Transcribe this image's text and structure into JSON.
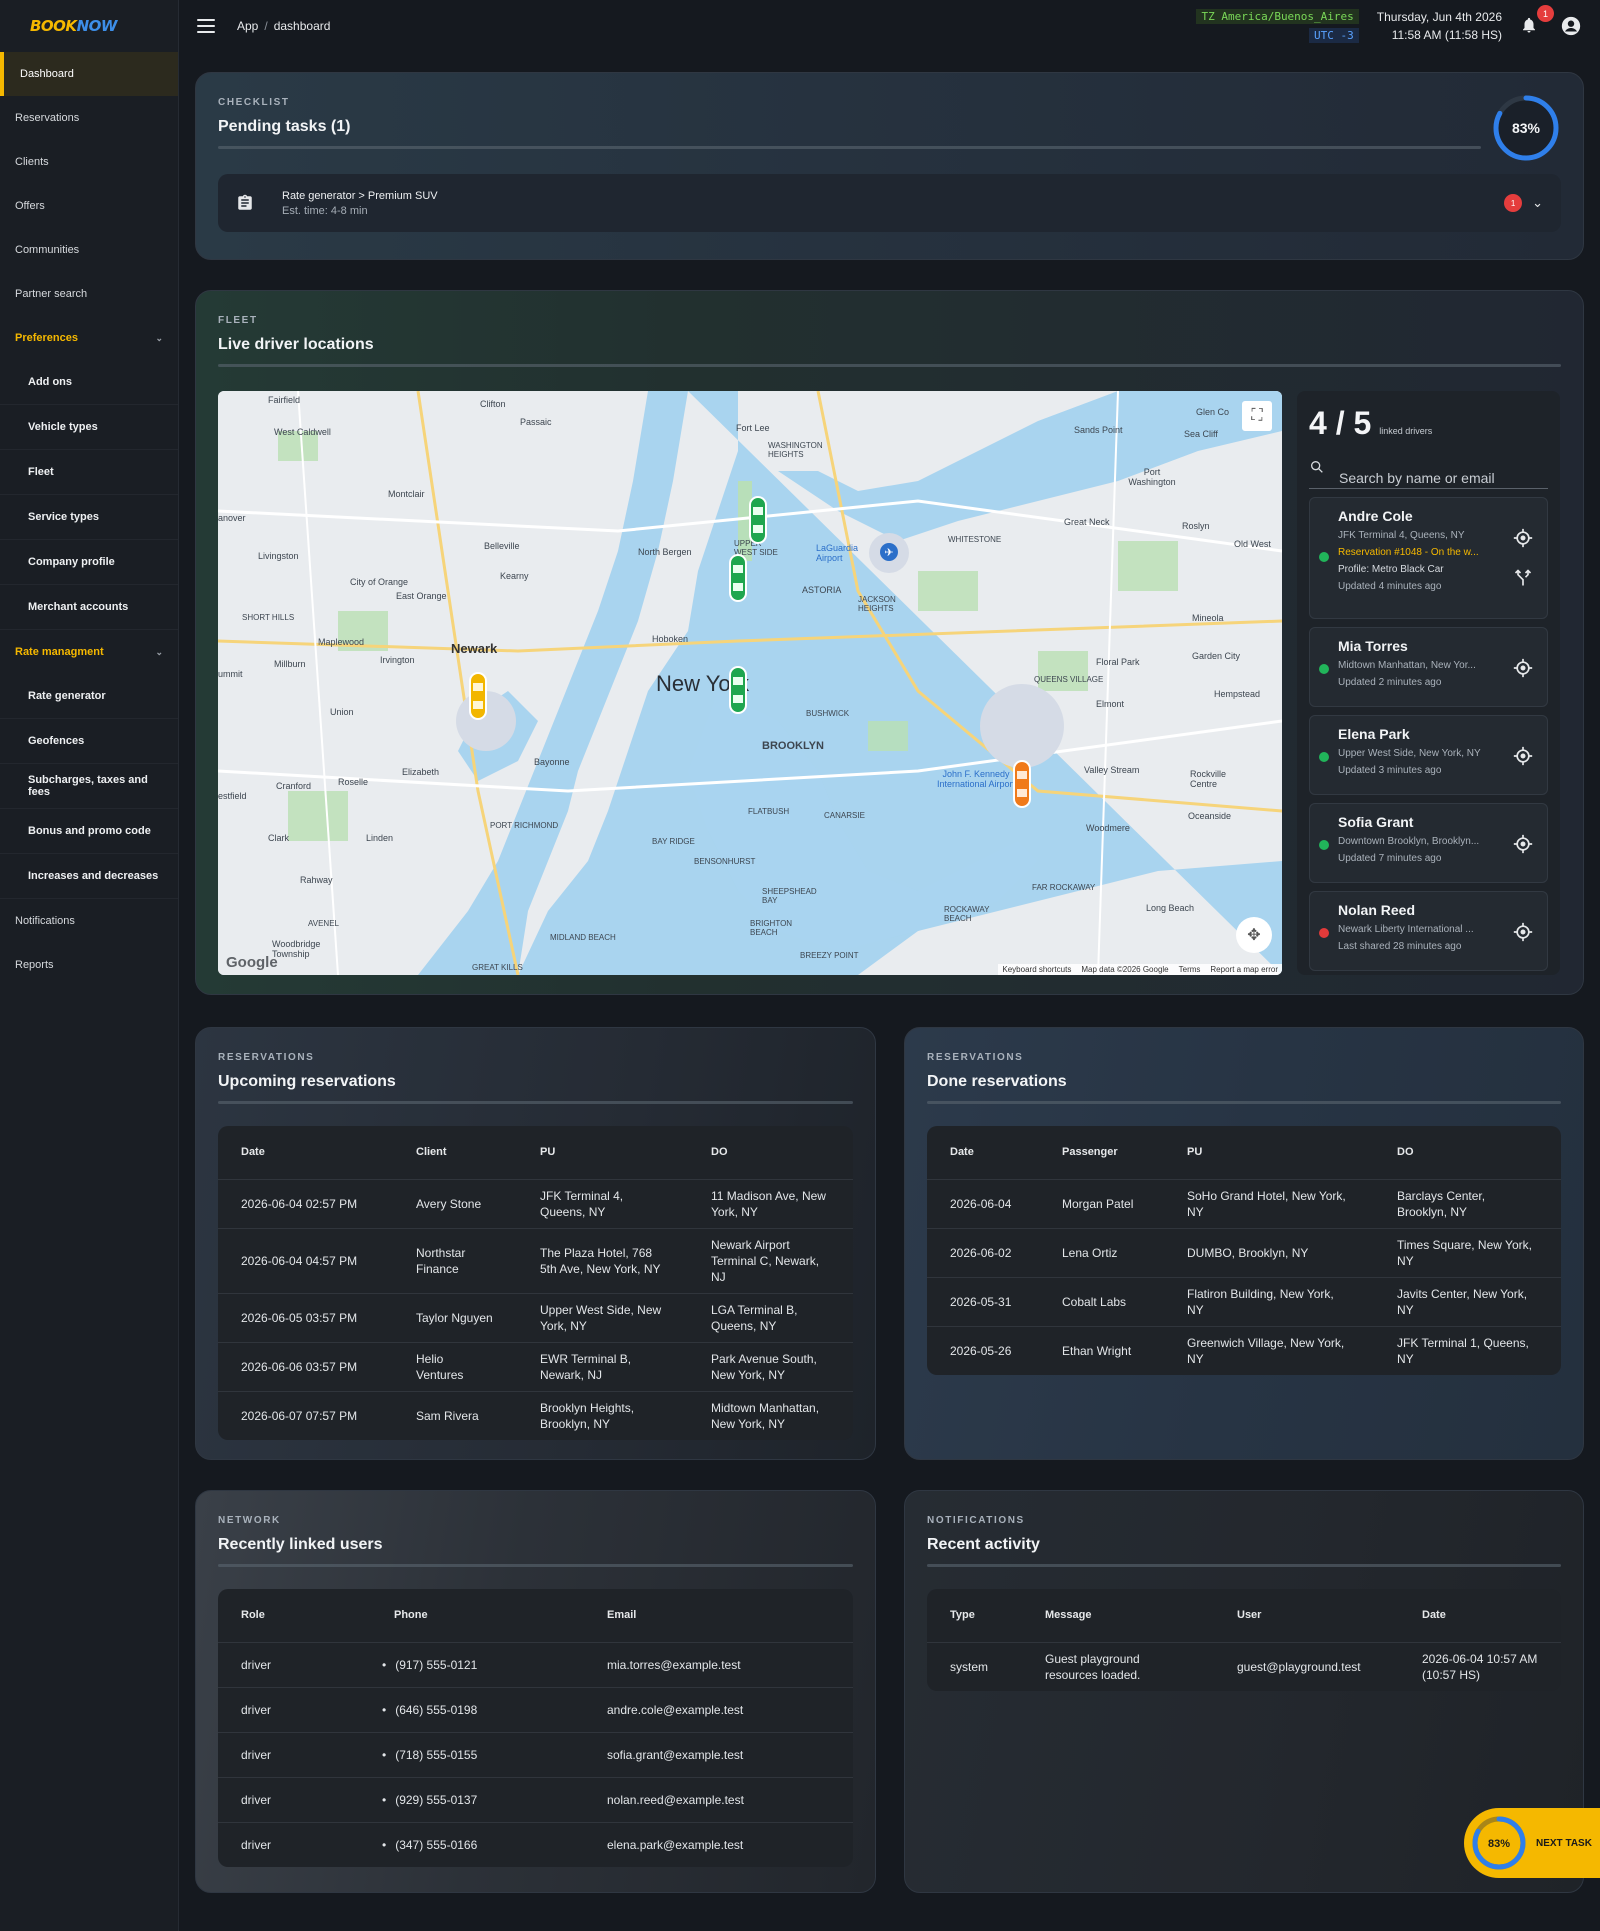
{
  "app": {
    "brand": "BOOKNOW",
    "brand_a": "BOOK",
    "brand_b": "NOW"
  },
  "sidebar": {
    "items": [
      {
        "label": "Dashboard"
      },
      {
        "label": "Reservations"
      },
      {
        "label": "Clients"
      },
      {
        "label": "Offers"
      },
      {
        "label": "Communities"
      },
      {
        "label": "Partner search"
      },
      {
        "label": "Preferences"
      },
      {
        "label": "Add ons"
      },
      {
        "label": "Vehicle types"
      },
      {
        "label": "Fleet"
      },
      {
        "label": "Service types"
      },
      {
        "label": "Company profile"
      },
      {
        "label": "Merchant accounts"
      },
      {
        "label": "Rate managment"
      },
      {
        "label": "Rate generator"
      },
      {
        "label": "Geofences"
      },
      {
        "label": "Subcharges, taxes and fees"
      },
      {
        "label": "Bonus and promo code"
      },
      {
        "label": "Increases and decreases"
      },
      {
        "label": "Notifications"
      },
      {
        "label": "Reports"
      }
    ]
  },
  "topbar": {
    "crumb_app": "App",
    "crumb_sep": "/",
    "crumb_page": "dashboard",
    "tz_name": "TZ America/Buenos_Aires",
    "tz_offset": "UTC -3",
    "date": "Thursday, Jun 4th 2026",
    "time": "11:58 AM (11:58 HS)",
    "notif_count": "1"
  },
  "checklist": {
    "label": "CHECKLIST",
    "title": "Pending tasks (1)",
    "progress_text": "83%",
    "progress": 0.83,
    "task_title": "Rate generator > Premium SUV",
    "task_sub": "Est. time: 4-8 min",
    "task_badge": "1"
  },
  "fleet": {
    "label": "FLEET",
    "title": "Live driver locations",
    "count": "4 / 5",
    "count_label": "linked drivers",
    "search_placeholder": "Search by name or email",
    "map_footer": {
      "google": "Google",
      "shortcuts": "Keyboard shortcuts",
      "mapdata": "Map data ©2026 Google",
      "terms": "Terms",
      "report": "Report a map error"
    },
    "map_labels": {
      "newyork": "New York",
      "newark": "Newark",
      "brooklyn": "BROOKLYN",
      "laguardia": "LaGuardia Airport",
      "jfk": "John F. Kennedy International Airport",
      "bayonne": "Bayonne",
      "hoboken": "Hoboken",
      "astoria": "ASTORIA",
      "fairfield": "Fairfield",
      "clifton": "Clifton",
      "passaic": "Passaic",
      "montclair": "Montclair",
      "elizabeth": "Elizabeth",
      "linden": "Linden",
      "rahway": "Rahway",
      "union": "Union",
      "flushing": "Floral Park",
      "valley": "Valley Stream",
      "hempstead": "Hempstead",
      "greatneck": "Great Neck",
      "fortlee": "Fort Lee",
      "northbergen": "North Bergen",
      "kearny": "Kearny",
      "eastorange": "East Orange",
      "irvington": "Irvington",
      "livingston": "Livingston",
      "westcaldwell": "West Caldwell",
      "sandspoint": "Sands Point",
      "glenco": "Glen Co",
      "seacliff": "Sea Cliff",
      "portwash": "Port Washington",
      "roslyn": "Roslyn",
      "mineola": "Mineola",
      "gardencity": "Garden City",
      "elmont": "Elmont",
      "woodmere": "Woodmere",
      "oceanside": "Oceanside",
      "longbeach": "Long Beach",
      "rockville": "Rockville Centre",
      "farrockaway": "FAR ROCKAWAY",
      "rockawaybeach": "ROCKAWAY BEACH",
      "breezy": "BREEZY POINT",
      "midland": "MIDLAND BEACH",
      "greatkills": "GREAT KILLS",
      "woodbridge": "Woodbridge Township",
      "clark": "Clark",
      "cranford": "Cranford",
      "roselle": "Roselle",
      "westfield": "estfield",
      "portrichmond": "PORT RICHMOND",
      "bayridge": "BAY RIDGE",
      "bensonhurst": "BENSONHURST",
      "flatbush": "FLATBUSH",
      "canarsie": "CANARSIE",
      "bushwick": "BUSHWICK",
      "sheepshead": "SHEEPSHEAD BAY",
      "brighton": "BRIGHTON BEACH",
      "jackson": "JACKSON HEIGHTS",
      "queensvillage": "QUEENS VILLAGE",
      "whitestone": "WHITESTONE",
      "washington": "WASHINGTON HEIGHTS",
      "upperwest": "UPPER WEST SIDE",
      "shorthills": "SHORT HILLS",
      "millburn": "Millburn",
      "maplewood": "Maplewood",
      "belleville": "Belleville",
      "cityoforange": "City of Orange",
      "avenel": "AVENEL",
      "oldwest": "Old West",
      "hanover": "anover",
      "summit": "ummit"
    },
    "drivers": [
      {
        "name": "Andre Cole",
        "loc": "JFK Terminal 4, Queens, NY",
        "res": "Reservation #1048 - On the w...",
        "profile": "Profile: Metro Black Car",
        "updated": "Updated 4 minutes ago",
        "status": "online"
      },
      {
        "name": "Mia Torres",
        "loc": "Midtown Manhattan, New Yor...",
        "updated": "Updated 2 minutes ago",
        "status": "online"
      },
      {
        "name": "Elena Park",
        "loc": "Upper West Side, New York, NY",
        "updated": "Updated 3 minutes ago",
        "status": "online"
      },
      {
        "name": "Sofia Grant",
        "loc": "Downtown Brooklyn, Brooklyn...",
        "updated": "Updated 7 minutes ago",
        "status": "online"
      },
      {
        "name": "Nolan Reed",
        "loc": "Newark Liberty International ...",
        "updated": "Last shared 28 minutes ago",
        "status": "offline"
      }
    ]
  },
  "upcoming": {
    "label": "RESERVATIONS",
    "title": "Upcoming reservations",
    "headers": [
      "Date",
      "Client",
      "PU",
      "DO"
    ],
    "rows": [
      [
        "2026-06-04 02:57 PM",
        "Avery Stone",
        "JFK Terminal 4, Queens, NY",
        "11 Madison Ave, New York, NY"
      ],
      [
        "2026-06-04 04:57 PM",
        "Northstar Finance",
        "The Plaza Hotel, 768 5th Ave, New York, NY",
        "Newark Airport Terminal C, Newark, NJ"
      ],
      [
        "2026-06-05 03:57 PM",
        "Taylor Nguyen",
        "Upper West Side, New York, NY",
        "LGA Terminal B, Queens, NY"
      ],
      [
        "2026-06-06 03:57 PM",
        "Helio Ventures",
        "EWR Terminal B, Newark, NJ",
        "Park Avenue South, New York, NY"
      ],
      [
        "2026-06-07 07:57 PM",
        "Sam Rivera",
        "Brooklyn Heights, Brooklyn, NY",
        "Midtown Manhattan, New York, NY"
      ]
    ]
  },
  "done": {
    "label": "RESERVATIONS",
    "title": "Done reservations",
    "headers": [
      "Date",
      "Passenger",
      "PU",
      "DO"
    ],
    "rows": [
      [
        "2026-06-04",
        "Morgan Patel",
        "SoHo Grand Hotel, New York, NY",
        "Barclays Center, Brooklyn, NY"
      ],
      [
        "2026-06-02",
        "Lena Ortiz",
        "DUMBO, Brooklyn, NY",
        "Times Square, New York, NY"
      ],
      [
        "2026-05-31",
        "Cobalt Labs",
        "Flatiron Building, New York, NY",
        "Javits Center, New York, NY"
      ],
      [
        "2026-05-26",
        "Ethan Wright",
        "Greenwich Village, New York, NY",
        "JFK Terminal 1, Queens, NY"
      ]
    ]
  },
  "network": {
    "label": "NETWORK",
    "title": "Recently linked users",
    "headers": [
      "Role",
      "Phone",
      "Email"
    ],
    "rows": [
      [
        "driver",
        "(917) 555-0121",
        "mia.torres@example.test"
      ],
      [
        "driver",
        "(646) 555-0198",
        "andre.cole@example.test"
      ],
      [
        "driver",
        "(718) 555-0155",
        "sofia.grant@example.test"
      ],
      [
        "driver",
        "(929) 555-0137",
        "nolan.reed@example.test"
      ],
      [
        "driver",
        "(347) 555-0166",
        "elena.park@example.test"
      ]
    ]
  },
  "notifications": {
    "label": "NOTIFICATIONS",
    "title": "Recent activity",
    "headers": [
      "Type",
      "Message",
      "User",
      "Date"
    ],
    "rows": [
      [
        "system",
        "Guest playground resources loaded.",
        "guest@playground.test",
        "2026-06-04 10:57 AM (10:57 HS)"
      ]
    ]
  },
  "fab": {
    "progress_text": "83%",
    "label": "NEXT TASK"
  },
  "colors": {
    "accent": "#f5b800",
    "blue": "#3d8ee8",
    "online": "#21b45a",
    "offline": "#e23a3a"
  }
}
